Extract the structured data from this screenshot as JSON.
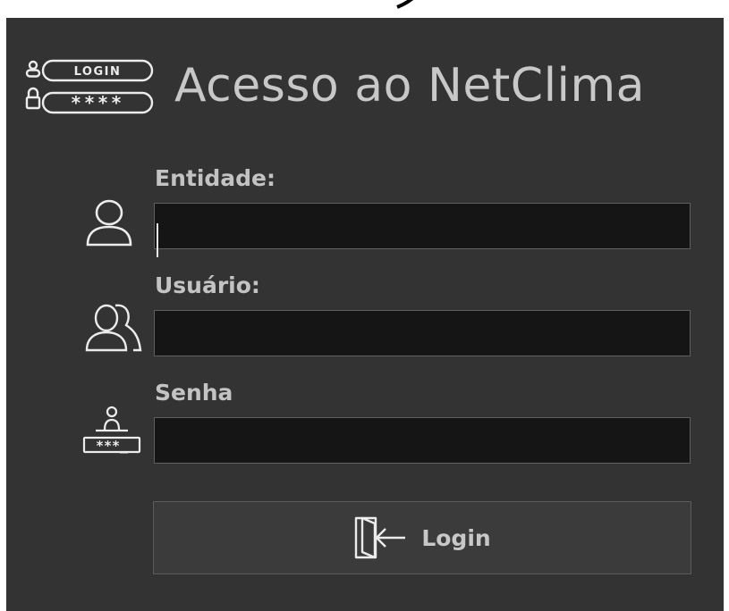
{
  "header": {
    "title": "Acesso ao NetClima",
    "logo_login_text": "LOGIN",
    "logo_password_text": "****"
  },
  "fields": {
    "entidade": {
      "label": "Entidade:",
      "value": "",
      "icon": "user-icon"
    },
    "usuario": {
      "label": "Usuário:",
      "value": "",
      "icon": "users-icon"
    },
    "senha": {
      "label": "Senha",
      "value": "",
      "icon": "user-password-icon",
      "icon_text": "***_"
    }
  },
  "login_button": {
    "label": "Login",
    "icon": "door-enter-icon"
  },
  "colors": {
    "window_bg": "#333333",
    "input_bg": "#151515",
    "text": "#c8c8c8",
    "border": "#5f5f5f"
  }
}
